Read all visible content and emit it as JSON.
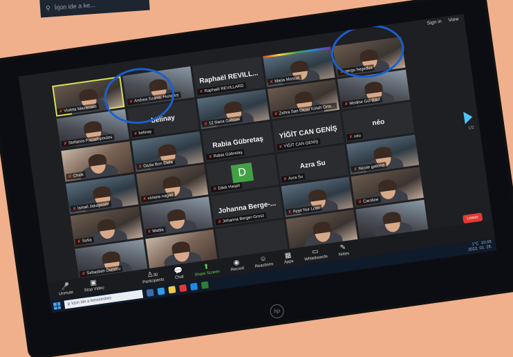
{
  "strip": {
    "search_text": "Írjon ide a ke..."
  },
  "topbar": {
    "signin": "Sign in",
    "view": "View"
  },
  "tiles": [
    {
      "name": "Violeta Mazaroaie",
      "kind": "video",
      "active": true
    },
    {
      "name": "Andrea Szanis, Hungary",
      "kind": "video"
    },
    {
      "name": "Raphaël REVILLARD",
      "big": "Raphaël REVILL...",
      "kind": "dark"
    },
    {
      "name": "Maria Moscat",
      "kind": "video"
    },
    {
      "name": "gergo hegedus",
      "kind": "video"
    },
    {
      "name": "Stefanos Papadopoulos",
      "kind": "video"
    },
    {
      "name": "belinay",
      "big": "belinay",
      "kind": "dark"
    },
    {
      "name": "12 Nana Gabbas",
      "kind": "video"
    },
    {
      "name": "Zehra San Olcay Kütah Orta...",
      "kind": "video"
    },
    {
      "name": "Medine Gül Bilici",
      "kind": "video"
    },
    {
      "name": "Chalk",
      "kind": "video"
    },
    {
      "name": "Giulia Bon Elefa",
      "kind": "video"
    },
    {
      "name": "Rabia Gübretaş",
      "big": "Rabia Gübretaş",
      "kind": "dark"
    },
    {
      "name": "YİĞİT CAN GENİŞ",
      "big": "YİĞİT CAN GENİŞ",
      "kind": "dark"
    },
    {
      "name": "néo",
      "big": "néo",
      "kind": "dark"
    },
    {
      "name": "Ismail Jakaganile",
      "kind": "video"
    },
    {
      "name": "viviane nagati",
      "kind": "video"
    },
    {
      "name": "Dilek Haspit",
      "kind": "avatar",
      "avatar_letter": "D"
    },
    {
      "name": "Azra Su",
      "big": "Azra Su",
      "kind": "dark"
    },
    {
      "name": "Nicole gallone",
      "kind": "video"
    },
    {
      "name": "Sofia",
      "kind": "video"
    },
    {
      "name": "Mattia",
      "kind": "video"
    },
    {
      "name": "Johanna Berger-Grosz",
      "big": "Johanna Berge-...",
      "kind": "dark"
    },
    {
      "name": "Ayşe Nur Lcan",
      "kind": "video"
    },
    {
      "name": "Caroline",
      "kind": "video"
    },
    {
      "name": "Sebastian Dumitru",
      "kind": "video"
    },
    {
      "name": "",
      "kind": "video"
    },
    {
      "name": "",
      "kind": "dark"
    },
    {
      "name": "",
      "kind": "video"
    },
    {
      "name": "",
      "kind": "video"
    }
  ],
  "nav": {
    "page": "1/2"
  },
  "leave_label": "Leave",
  "toolbar": {
    "unmute": "Unmute",
    "stop_video": "Stop Video",
    "participants": "Participants",
    "participants_count": "30",
    "chat": "Chat",
    "share_screen": "Share Screen",
    "record": "Record",
    "reactions": "Reactions",
    "apps": "Apps",
    "whiteboards": "Whiteboards",
    "notes": "Notes"
  },
  "taskbar": {
    "search_placeholder": "Írjon ide a kereséshez",
    "temperature": "1°C",
    "time": "10:08",
    "date": "2022. 01. 28."
  },
  "brand": "hp"
}
